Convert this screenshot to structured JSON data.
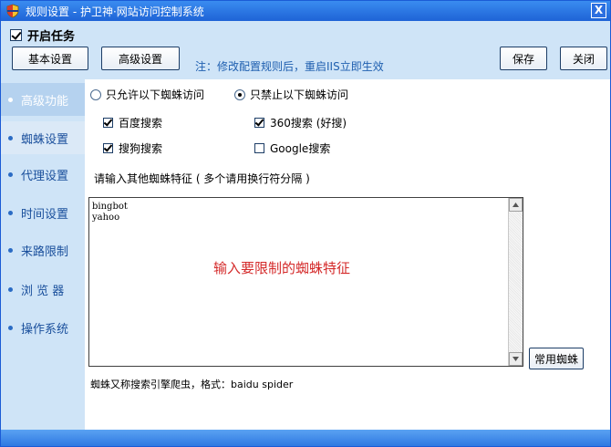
{
  "window": {
    "title": "规则设置 - 护卫神·网站访问控制系统",
    "close_label": "X"
  },
  "toolbar": {
    "enable_label": "开启任务",
    "enable_checked": true,
    "basic_label": "基本设置",
    "advanced_label": "高级设置",
    "note": "注：修改配置规则后，重启IIS立即生效",
    "save_label": "保存",
    "close_label": "关闭"
  },
  "sidebar": {
    "items": [
      {
        "label": "高级功能",
        "state": "active"
      },
      {
        "label": "蜘蛛设置",
        "state": "selected"
      },
      {
        "label": "代理设置",
        "state": "normal"
      },
      {
        "label": "时间设置",
        "state": "normal"
      },
      {
        "label": "来路限制",
        "state": "normal"
      },
      {
        "label": "浏 览 器",
        "state": "normal"
      },
      {
        "label": "操作系统",
        "state": "normal"
      }
    ]
  },
  "main": {
    "mode": {
      "allow_label": "只允许以下蜘蛛访问",
      "deny_label": "只禁止以下蜘蛛访问",
      "selected": "deny"
    },
    "spiders": [
      {
        "label": "百度搜索",
        "checked": true
      },
      {
        "label": "360搜索 (好搜)",
        "checked": true
      },
      {
        "label": "搜狗搜索",
        "checked": true
      },
      {
        "label": "Google搜索",
        "checked": false
      }
    ],
    "prompt": "请输入其他蜘蛛特征 ( 多个请用换行符分隔 )",
    "textarea_value": "bingbot\nyahoo",
    "textarea_hint": "输入要限制的蜘蛛特征",
    "common_button": "常用蜘蛛",
    "footnote": "蜘蛛又称搜索引擎爬虫，格式：baidu spider"
  },
  "colors": {
    "titlebar": "#1e63d6",
    "sidebar_bg": "#cfe4f7",
    "sidebar_text": "#1a4f9c",
    "hint_red": "#d42a2a",
    "note_blue": "#2060b0"
  }
}
